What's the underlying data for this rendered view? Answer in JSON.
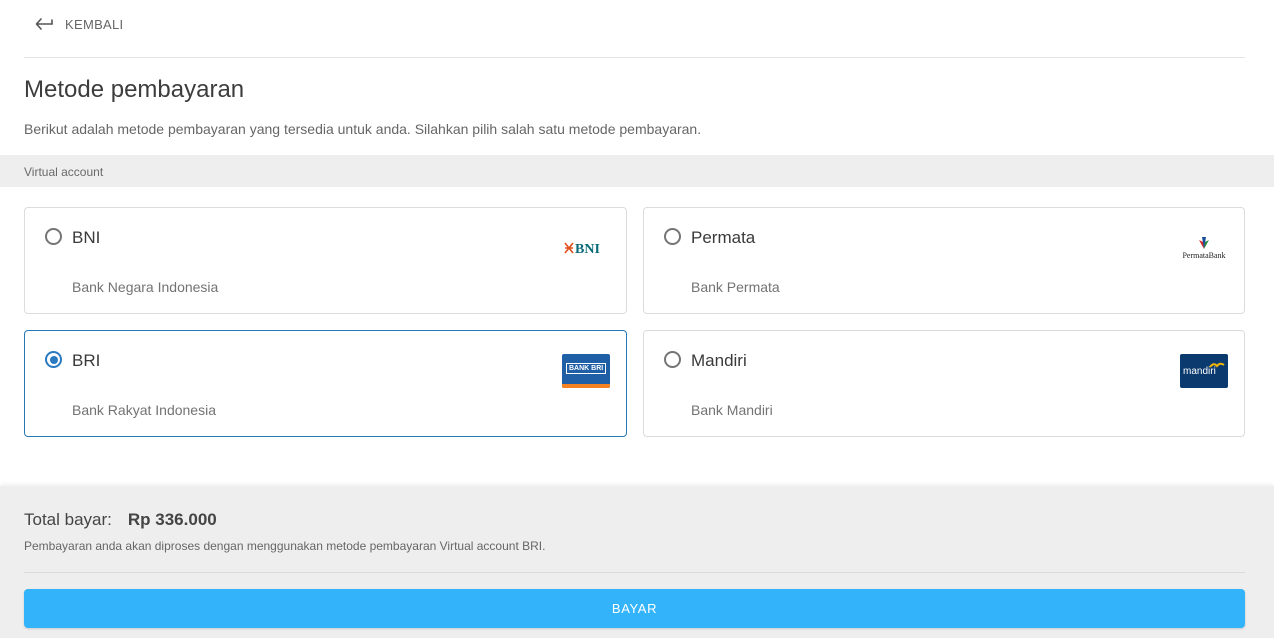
{
  "header": {
    "back_label": "KEMBALI"
  },
  "page": {
    "title": "Metode pembayaran",
    "description": "Berikut adalah metode pembayaran yang tersedia untuk anda. Silahkan pilih salah satu metode pembayaran."
  },
  "section": {
    "label": "Virtual account"
  },
  "methods": [
    {
      "name": "BNI",
      "full_name": "Bank Negara Indonesia",
      "logo": "bni-logo",
      "selected": false
    },
    {
      "name": "Permata",
      "full_name": "Bank Permata",
      "logo": "permata-logo",
      "logo_text": "PermataBank",
      "selected": false
    },
    {
      "name": "BRI",
      "full_name": "Bank Rakyat Indonesia",
      "logo": "bri-logo",
      "logo_text": "BANK BRI",
      "selected": true
    },
    {
      "name": "Mandiri",
      "full_name": "Bank Mandiri",
      "logo": "mandiri-logo",
      "logo_text": "mandiri",
      "selected": false
    }
  ],
  "footer": {
    "total_label": "Total bayar:",
    "total_value": "Rp 336.000",
    "note": "Pembayaran anda akan diproses dengan menggunakan metode pembayaran Virtual account BRI.",
    "pay_label": "BAYAR"
  },
  "colors": {
    "accent": "#2b7ac1",
    "button": "#33b3fa",
    "bni_orange": "#e0501f",
    "bni_teal": "#0a6b78",
    "bri_blue": "#1f5fa6",
    "mandiri_navy": "#0b3a6e"
  }
}
